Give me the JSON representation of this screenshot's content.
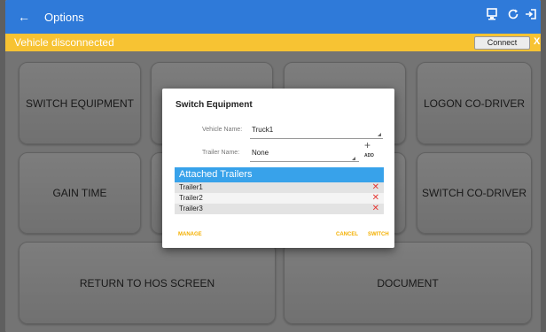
{
  "appbar": {
    "title": "Options"
  },
  "status": {
    "message": "Vehicle disconnected",
    "connect_label": "Connect",
    "dismiss_label": "X"
  },
  "tiles": {
    "switch_equipment": "SWITCH EQUIPMENT",
    "logon_codriver": "LOGON CO-DRIVER",
    "gain_time": "GAIN TIME",
    "switch_codriver": "SWITCH CO-DRIVER",
    "return_hos": "RETURN TO HOS SCREEN",
    "document": "DOCUMENT"
  },
  "dialog": {
    "title": "Switch Equipment",
    "vehicle_label": "Vehicle Name:",
    "vehicle_value": "Truck1",
    "trailer_label": "Trailer Name:",
    "trailer_value": "None",
    "add_symbol": "+",
    "add_label": "ADD",
    "attached_header": "Attached Trailers",
    "trailers": [
      "Trailer1",
      "Trailer2",
      "Trailer3"
    ],
    "remove_symbol": "✕",
    "manage_label": "MANAGE",
    "cancel_label": "CANCEL",
    "switch_label": "SWITCH"
  },
  "icons": {
    "back": "back-arrow-icon",
    "device": "device-icon",
    "refresh": "refresh-icon",
    "logout": "logout-icon"
  },
  "colors": {
    "appbar": "#2f7ad9",
    "status": "#f7c333",
    "trailer_header": "#38a2ea",
    "accent": "#f4b000",
    "delete": "#e53935"
  }
}
